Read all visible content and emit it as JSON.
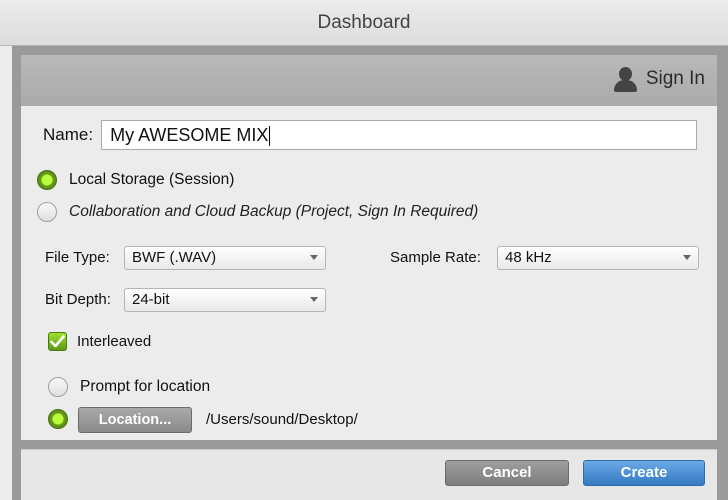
{
  "window": {
    "title": "Dashboard"
  },
  "header": {
    "sign_in_label": "Sign In"
  },
  "form": {
    "name_label": "Name:",
    "name_value": "My AWESOME MIX",
    "storage_options": [
      {
        "label": "Local Storage (Session)",
        "selected": true
      },
      {
        "label": "Collaboration and Cloud Backup (Project, Sign In Required)",
        "selected": false
      }
    ],
    "file_type": {
      "label": "File Type:",
      "value": "BWF (.WAV)"
    },
    "sample_rate": {
      "label": "Sample Rate:",
      "value": "48 kHz"
    },
    "bit_depth": {
      "label": "Bit Depth:",
      "value": "24-bit"
    },
    "interleaved": {
      "label": "Interleaved",
      "checked": true
    },
    "location": {
      "prompt_label": "Prompt for location",
      "button_label": "Location...",
      "path": "/Users/sound/Desktop/"
    }
  },
  "footer": {
    "cancel_label": "Cancel",
    "create_label": "Create"
  },
  "colors": {
    "accent_green": "#7ec220",
    "create_blue": "#3c80c8"
  }
}
